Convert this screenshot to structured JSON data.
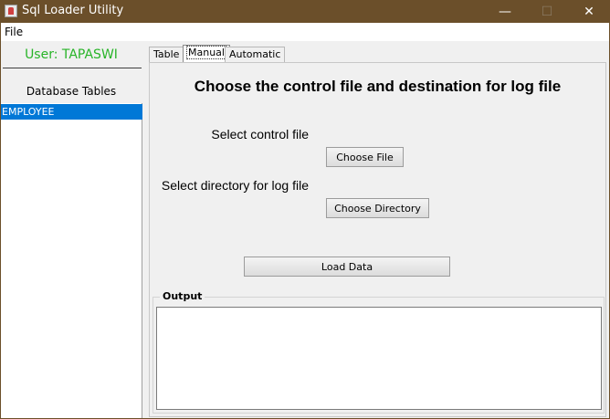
{
  "window": {
    "title": "Sql Loader Utility"
  },
  "titlebar_controls": {
    "minimize": "—",
    "maximize": "☐",
    "close": "✕"
  },
  "menu": {
    "file": "File"
  },
  "sidebar": {
    "user_label": "User: TAPASWI",
    "heading": "Database Tables",
    "tables": [
      {
        "label": "EMPLOYEE",
        "selected": true
      }
    ]
  },
  "tabs": [
    {
      "label": "Table",
      "active": false
    },
    {
      "label": "Manual",
      "active": true
    },
    {
      "label": "Automatic",
      "active": false
    }
  ],
  "manual": {
    "heading": "Choose the control file and destination for log file",
    "control_label": "Select control file",
    "choose_file": "Choose File",
    "dir_label": "Select directory for log file",
    "choose_directory": "Choose Directory",
    "load_data": "Load Data"
  },
  "output": {
    "title": "Output",
    "text": ""
  },
  "colors": {
    "titlebar": "#6b4f2a",
    "user_label": "#28b428",
    "selection": "#0078d7"
  }
}
